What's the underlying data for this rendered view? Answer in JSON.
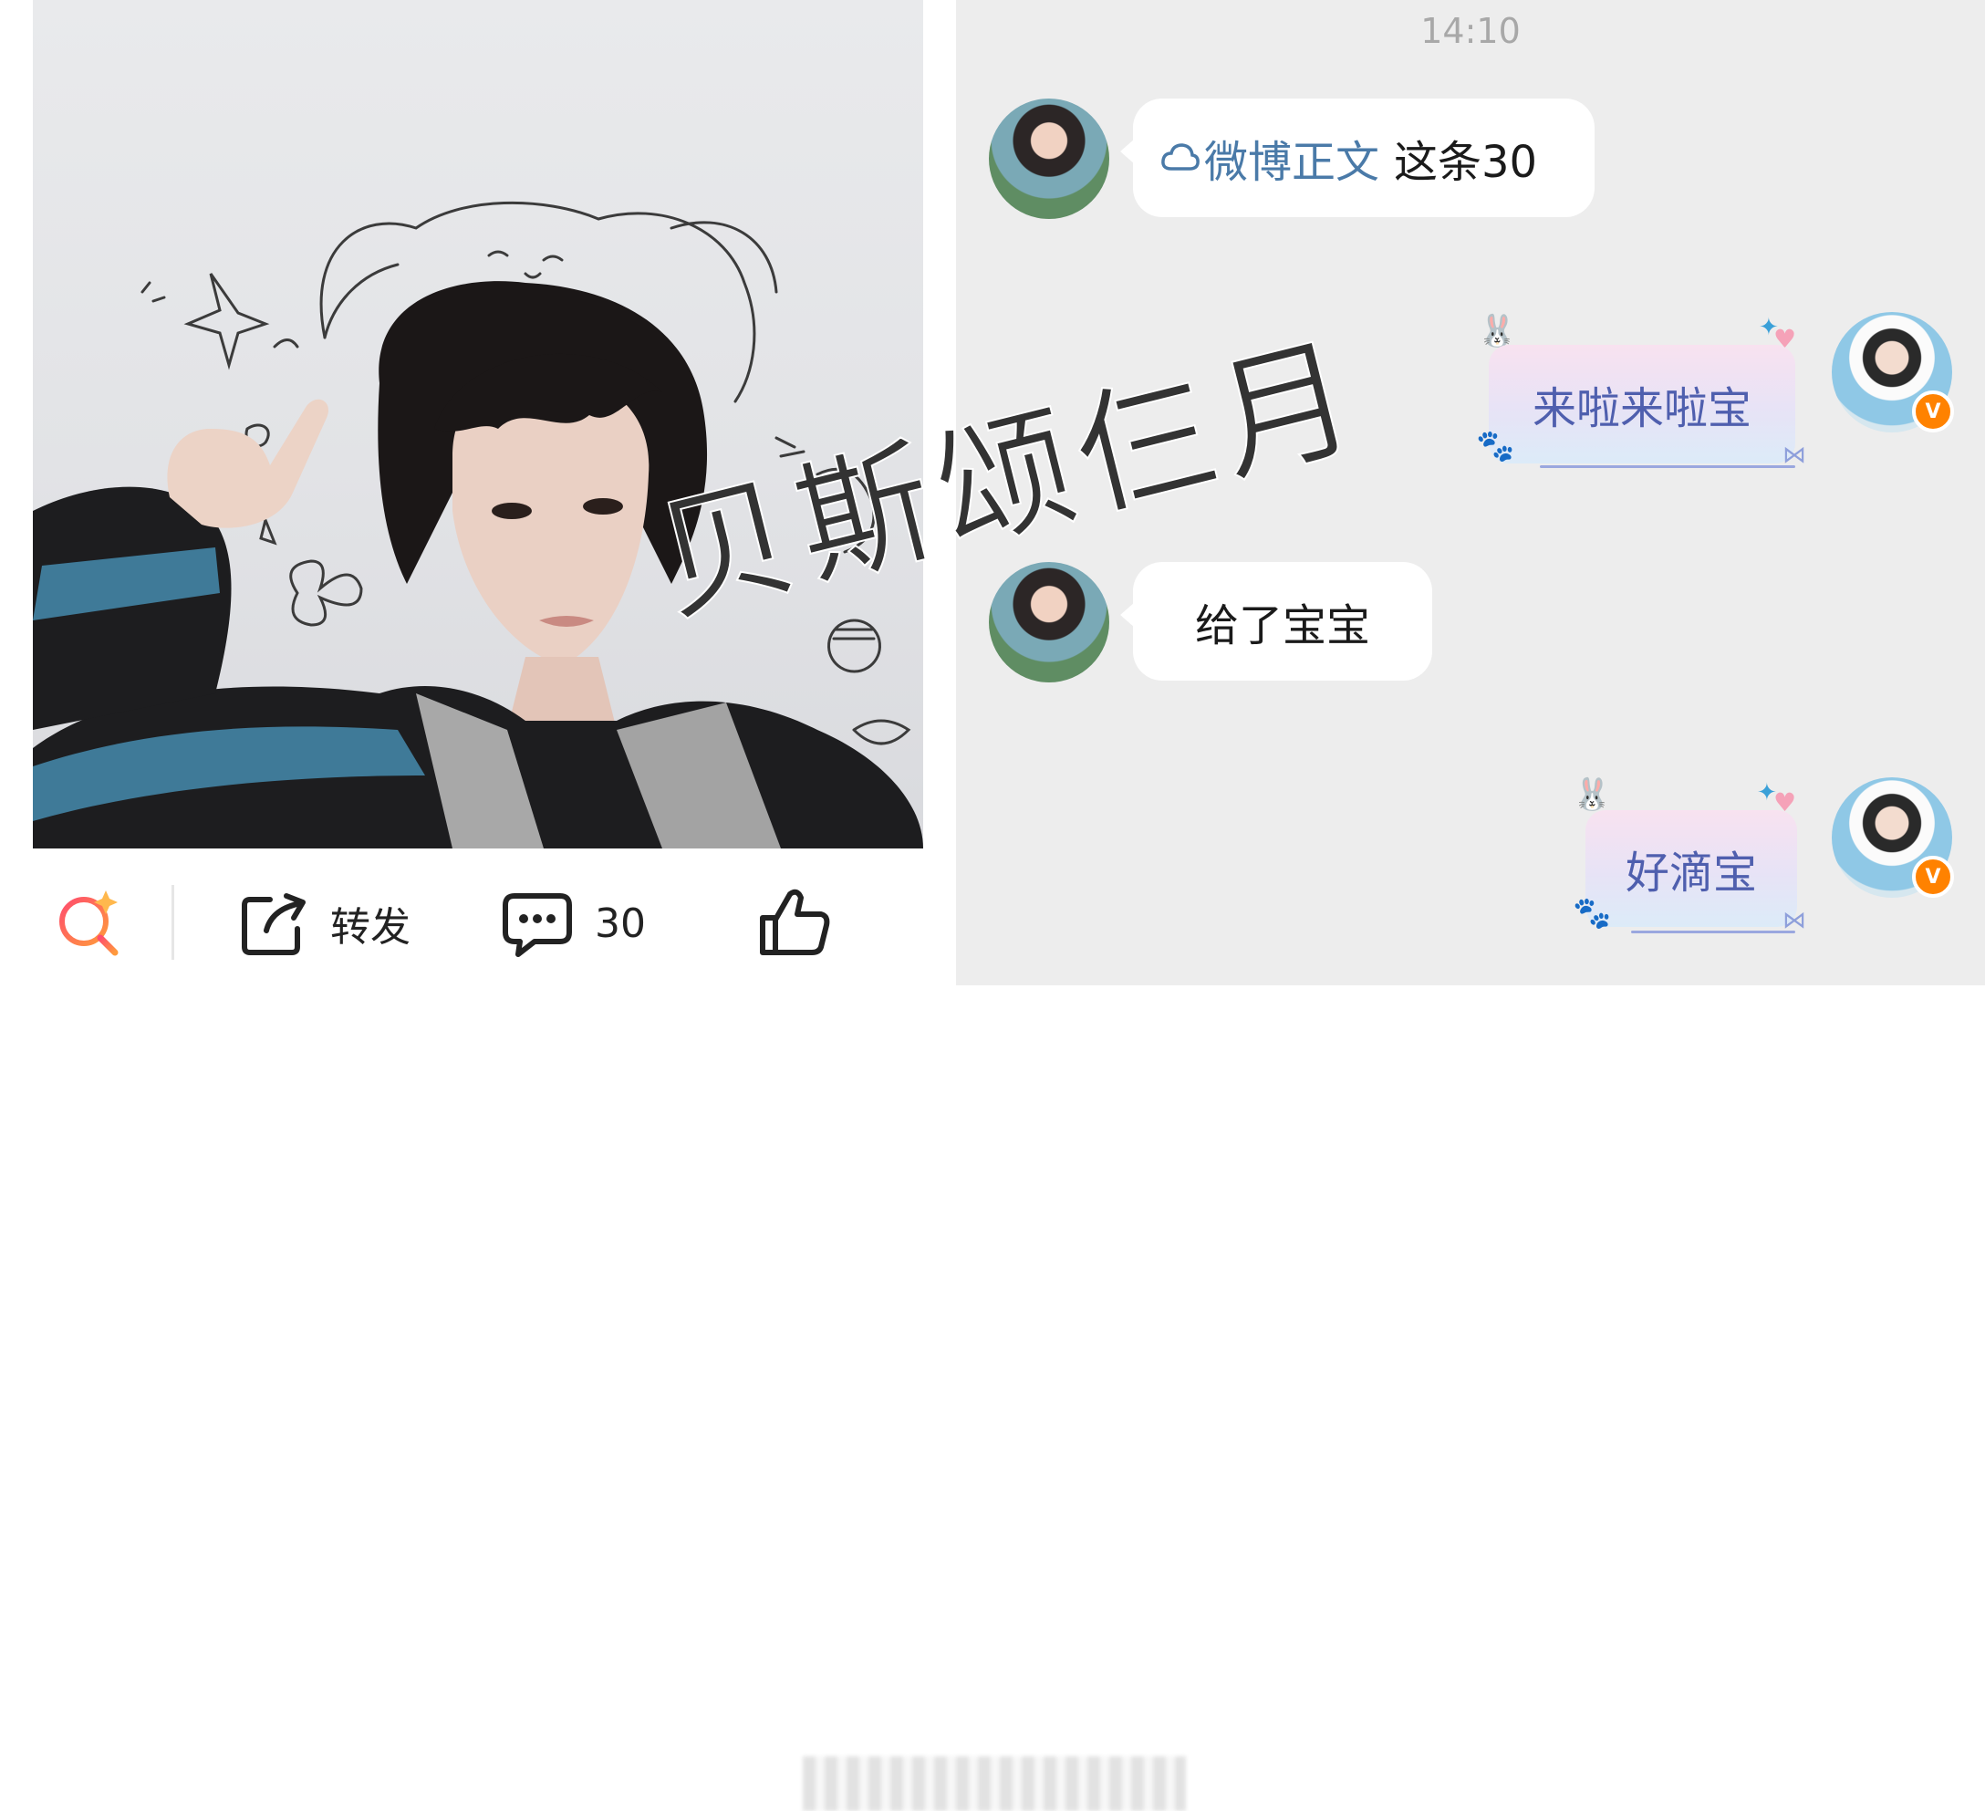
{
  "post": {
    "actions": {
      "repost_label": "转发",
      "comment_count": "30"
    }
  },
  "chat": {
    "time": "14:10",
    "messages": [
      {
        "side": "left",
        "prefix_link": "微博正文",
        "text": "这条30"
      },
      {
        "side": "right",
        "text": "来啦来啦宝"
      },
      {
        "side": "left",
        "text": "给了宝宝"
      },
      {
        "side": "right",
        "text": "好滴宝"
      }
    ],
    "verified_badge": "V"
  },
  "watermark": "贝斯颂仨月",
  "colors": {
    "chat_bg": "#ededed",
    "link": "#4a7aa8",
    "cute_text": "#4f5fae",
    "badge": "#ff8200",
    "search_icon_gradient": [
      "#ff4d6d",
      "#ff9a3c"
    ]
  },
  "icons": [
    "ai-search-icon",
    "repost-icon",
    "comment-icon",
    "like-icon",
    "cloud-link-icon"
  ]
}
